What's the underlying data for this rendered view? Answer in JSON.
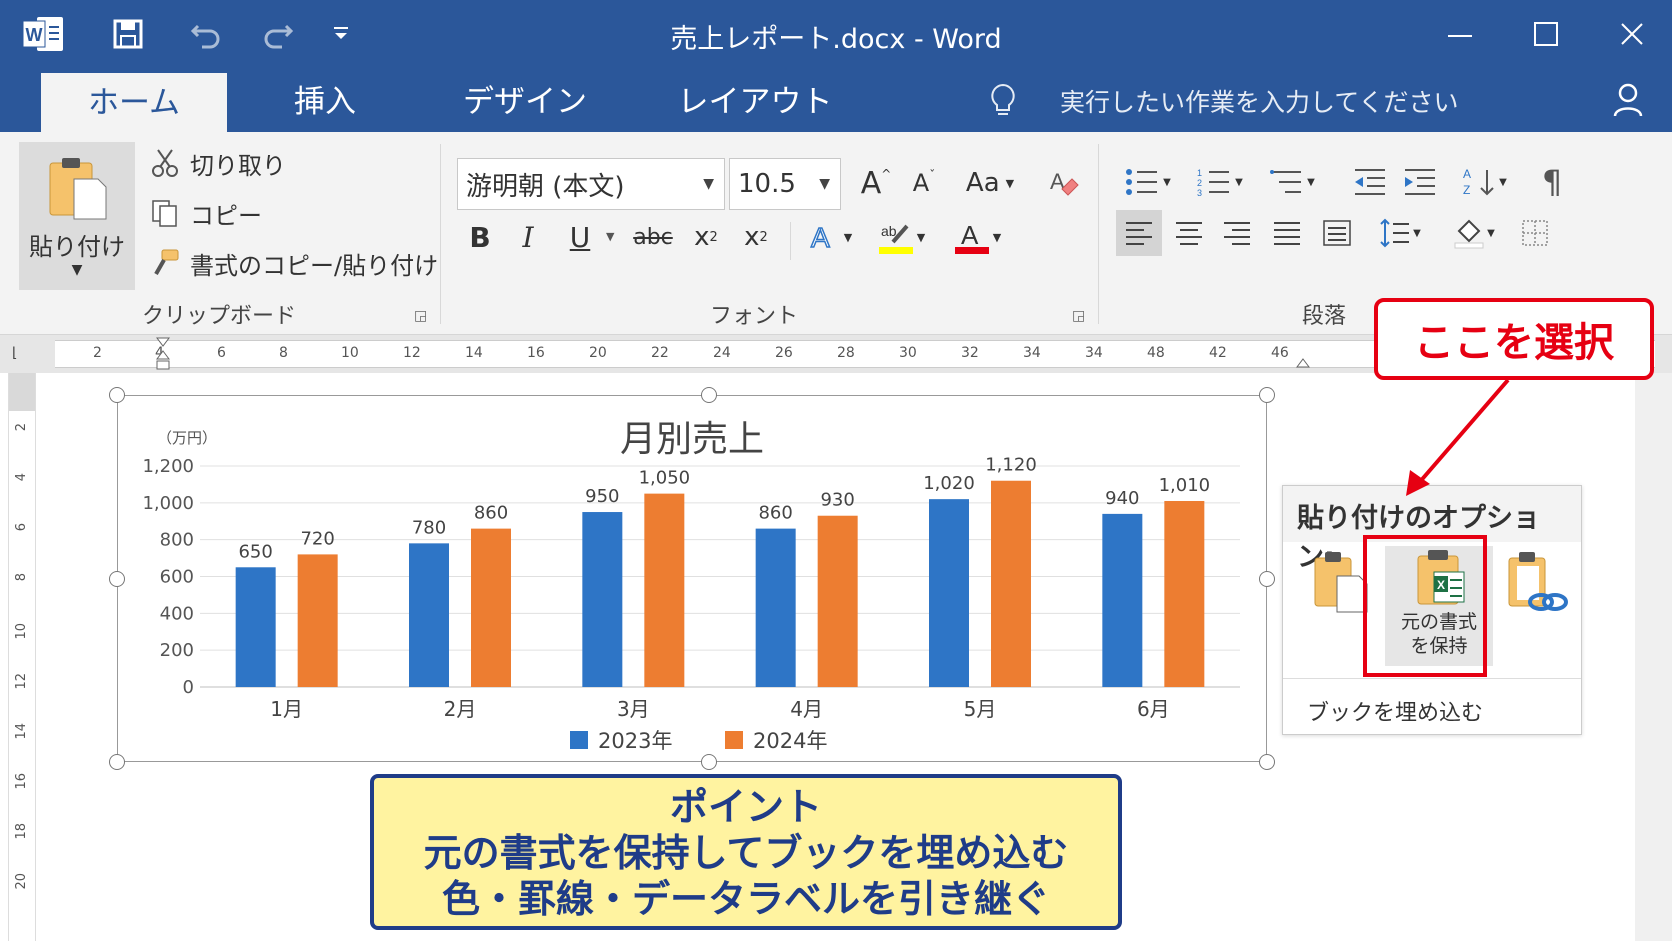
{
  "window": {
    "title": "売上レポート.docx - Word"
  },
  "tabs": [
    {
      "label": "ホーム",
      "active": true
    },
    {
      "label": "挿入"
    },
    {
      "label": "デザイン"
    },
    {
      "label": "レイアウト"
    }
  ],
  "search": {
    "placeholder": "実行したい作業を入力してください"
  },
  "clipboard": {
    "paste_label": "貼り付け",
    "cut_label": "切り取り",
    "copy_label": "コピー",
    "format_painter_label": "書式のコピー/貼り付け",
    "group_label": "クリップボード"
  },
  "font": {
    "family": "游明朝 (本文)",
    "size": "10.5",
    "grow_label": "A",
    "shrink_label": "A",
    "case_label": "Aa",
    "bold": "B",
    "italic": "I",
    "underline": "U",
    "strike": "abc",
    "sub": "x",
    "sup": "x",
    "group_label": "フォント"
  },
  "paragraph": {
    "group_label": "段落"
  },
  "ruler": {
    "ticks": [
      "2",
      "4",
      "6",
      "8",
      "10",
      "12",
      "14",
      "16",
      "20",
      "22",
      "24",
      "26",
      "28",
      "30",
      "32",
      "34",
      "34",
      "48",
      "42",
      "46"
    ]
  },
  "vruler": {
    "ticks": [
      "2",
      "4",
      "6",
      "8",
      "10",
      "12",
      "14",
      "16",
      "18",
      "20"
    ]
  },
  "chart_data": {
    "type": "bar",
    "title": "月別売上",
    "unit_label": "（万円）",
    "categories": [
      "1月",
      "2月",
      "3月",
      "4月",
      "5月",
      "6月"
    ],
    "series": [
      {
        "name": "2023年",
        "color": "#2e75c6",
        "values": [
          650,
          780,
          950,
          860,
          1020,
          940
        ],
        "labels": [
          "650",
          "780",
          "950",
          "860",
          "1,020",
          "940"
        ]
      },
      {
        "name": "2024年",
        "color": "#ed7d31",
        "values": [
          720,
          860,
          1050,
          930,
          1120,
          1010
        ],
        "labels": [
          "720",
          "860",
          "1,050",
          "930",
          "1,120",
          "1,010"
        ]
      }
    ],
    "ylim": [
      0,
      1200
    ],
    "yticks": [
      "0",
      "200",
      "400",
      "600",
      "800",
      "1,000",
      "1,200"
    ],
    "grid": true,
    "legend": "bottom"
  },
  "paste_options": {
    "header": "貼り付けのオプション:",
    "keep_source_label_1": "元の書式",
    "keep_source_label_2": "を保持",
    "footer": "ブックを埋め込む"
  },
  "callout": {
    "text": "ここを選択"
  },
  "point": {
    "line1": "ポイント",
    "line2": "元の書式を保持してブックを埋め込む",
    "line3": "色・罫線・データラベルを引き継ぐ"
  },
  "colors": {
    "accent": "#2b579a",
    "highlight": "#e60012",
    "point_bg": "#fff3a0",
    "point_border": "#1f3c88"
  }
}
